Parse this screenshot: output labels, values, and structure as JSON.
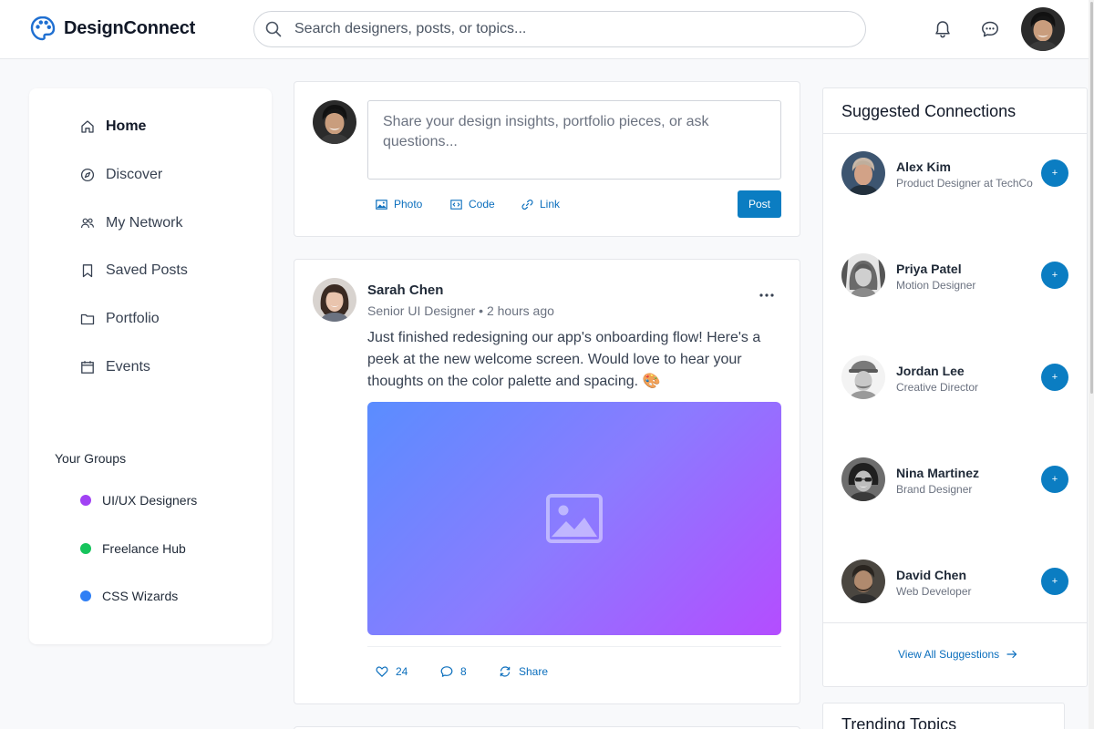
{
  "header": {
    "brand": "DesignConnect",
    "search_placeholder": "Search designers, posts, or topics...",
    "icons": [
      "palette-icon",
      "search-icon",
      "bell-icon",
      "chat-icon"
    ]
  },
  "sidebar": {
    "nav": [
      {
        "label": "Home",
        "icon": "home-icon",
        "active": true
      },
      {
        "label": "Discover",
        "icon": "compass-icon"
      },
      {
        "label": "My Network",
        "icon": "users-icon"
      },
      {
        "label": "Saved Posts",
        "icon": "bookmark-icon"
      },
      {
        "label": "Portfolio",
        "icon": "folder-icon"
      },
      {
        "label": "Events",
        "icon": "calendar-icon"
      }
    ],
    "groups_title": "Your Groups",
    "groups": [
      {
        "label": "UI/UX Designers",
        "color": "#a142f4"
      },
      {
        "label": "Freelance Hub",
        "color": "#16c45c"
      },
      {
        "label": "CSS Wizards",
        "color": "#2f7ff5"
      }
    ]
  },
  "composer": {
    "placeholder": "Share your design insights, portfolio pieces, or ask questions...",
    "actions": [
      "Photo",
      "Code",
      "Link"
    ],
    "post_label": "Post"
  },
  "post": {
    "author": "Sarah Chen",
    "meta": "Senior UI Designer • 2 hours ago",
    "text": "Just finished redesigning our app's onboarding flow! Here's a peek at the new welcome screen. Would love to hear your thoughts on the color palette and spacing. 🎨",
    "likes": "24",
    "comments": "8",
    "share_label": "Share"
  },
  "suggestions": {
    "title": "Suggested Connections",
    "items": [
      {
        "name": "Alex Kim",
        "role": "Product Designer at TechCo",
        "add": "+"
      },
      {
        "name": "Priya Patel",
        "role": "Motion Designer",
        "add": "+"
      },
      {
        "name": "Jordan Lee",
        "role": "Creative Director",
        "add": "+"
      },
      {
        "name": "Nina Martinez",
        "role": "Brand Designer",
        "add": "+"
      },
      {
        "name": "David Chen",
        "role": "Web Developer",
        "add": "+"
      }
    ],
    "view_all": "View All Suggestions"
  },
  "trending": {
    "title": "Trending Topics"
  },
  "colors": {
    "accent": "#0b7dc2",
    "link": "#0a6ebd",
    "brand": "#1f6fd1"
  }
}
